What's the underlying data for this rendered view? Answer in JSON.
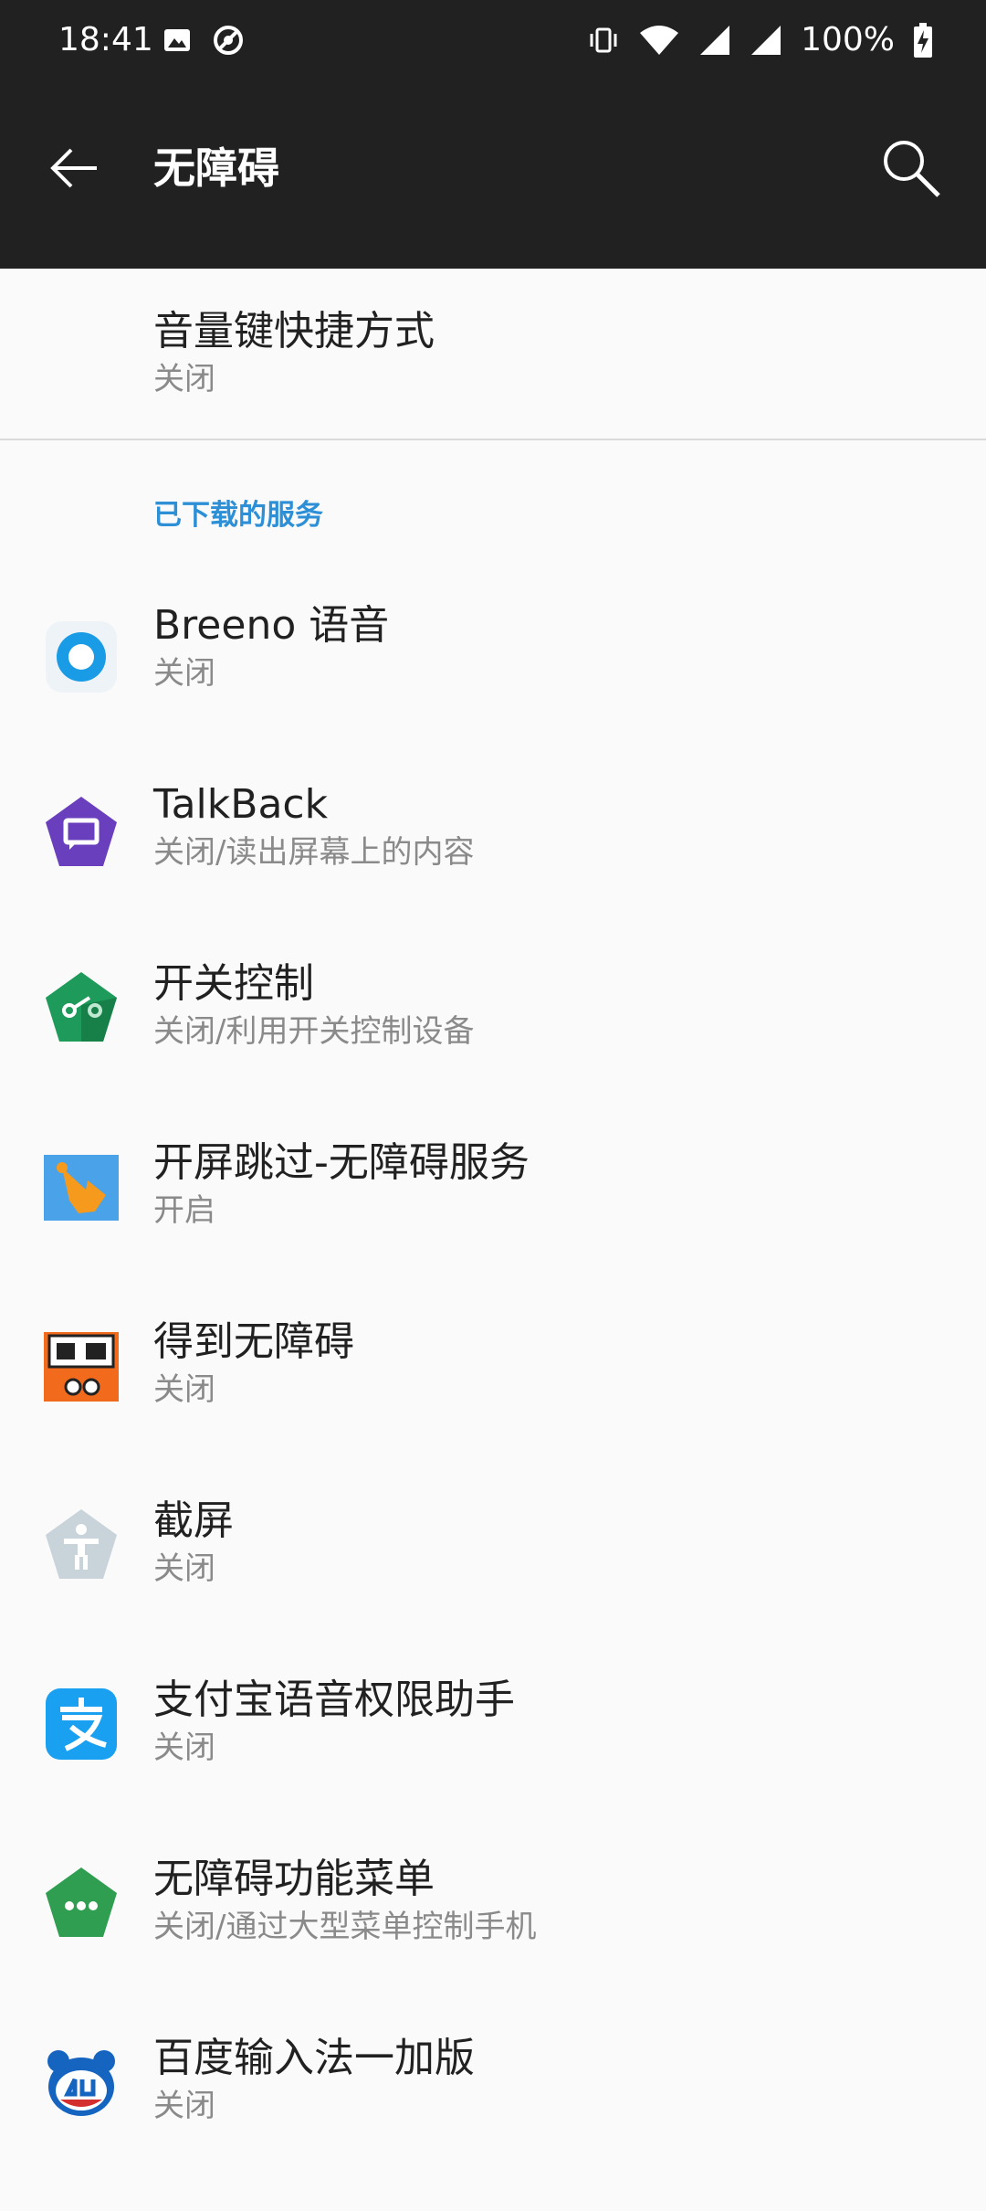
{
  "status_bar": {
    "time": "18:41",
    "battery_text": "100%"
  },
  "app_bar": {
    "title": "无障碍",
    "back_icon": "arrow-left-icon",
    "search_icon": "search-icon"
  },
  "shortcut": {
    "title": "音量键快捷方式",
    "state": "关闭"
  },
  "section": {
    "downloaded_services": "已下载的服务"
  },
  "services": [
    {
      "name": "Breeno 语音",
      "state": "关闭",
      "icon": "breeno-icon",
      "color": "#1a9be6"
    },
    {
      "name": "TalkBack",
      "state": "关闭/读出屏幕上的内容",
      "icon": "talkback-icon",
      "color": "#6a3fbd"
    },
    {
      "name": "开关控制",
      "state": "关闭/利用开关控制设备",
      "icon": "switch-control-icon",
      "color": "#1e9a5a"
    },
    {
      "name": "开屏跳过-无障碍服务",
      "state": "开启",
      "icon": "skip-ad-icon",
      "color": "#4aa3e8"
    },
    {
      "name": "得到无障碍",
      "state": "关闭",
      "icon": "dedao-icon",
      "color": "#f26b1d"
    },
    {
      "name": "截屏",
      "state": "关闭",
      "icon": "accessibility-person-icon",
      "color": "#c9d3da"
    },
    {
      "name": "支付宝语音权限助手",
      "state": "关闭",
      "icon": "alipay-icon",
      "color": "#1aa0f0"
    },
    {
      "name": "无障碍功能菜单",
      "state": "关闭/通过大型菜单控制手机",
      "icon": "accessibility-menu-icon",
      "color": "#2f9e50"
    },
    {
      "name": "百度输入法一加版",
      "state": "关闭",
      "icon": "baidu-input-icon",
      "color": "#1565c0"
    }
  ]
}
